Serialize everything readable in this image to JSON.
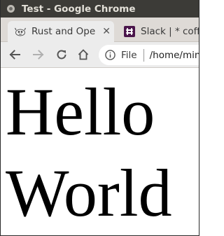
{
  "window": {
    "title": "Test - Google Chrome"
  },
  "tabs": [
    {
      "title": "Rust and Ope",
      "icon": "ferris-crab-icon",
      "active": true
    },
    {
      "title": "Slack | * coff",
      "icon": "slack-icon",
      "active": false
    }
  ],
  "toolbar": {
    "back_icon": "arrow-left-icon",
    "forward_icon": "arrow-right-icon",
    "reload_icon": "reload-icon",
    "home_icon": "home-icon"
  },
  "omnibox": {
    "security_icon": "info-icon",
    "scheme_label": "File",
    "url": "/home/min"
  },
  "page": {
    "text": "Hello\nWorld"
  },
  "colors": {
    "titlebar": "#3c3b37",
    "tabstrip": "#dedad6",
    "toolbar": "#ececec",
    "slack_icon_bg": "#4a154b"
  }
}
